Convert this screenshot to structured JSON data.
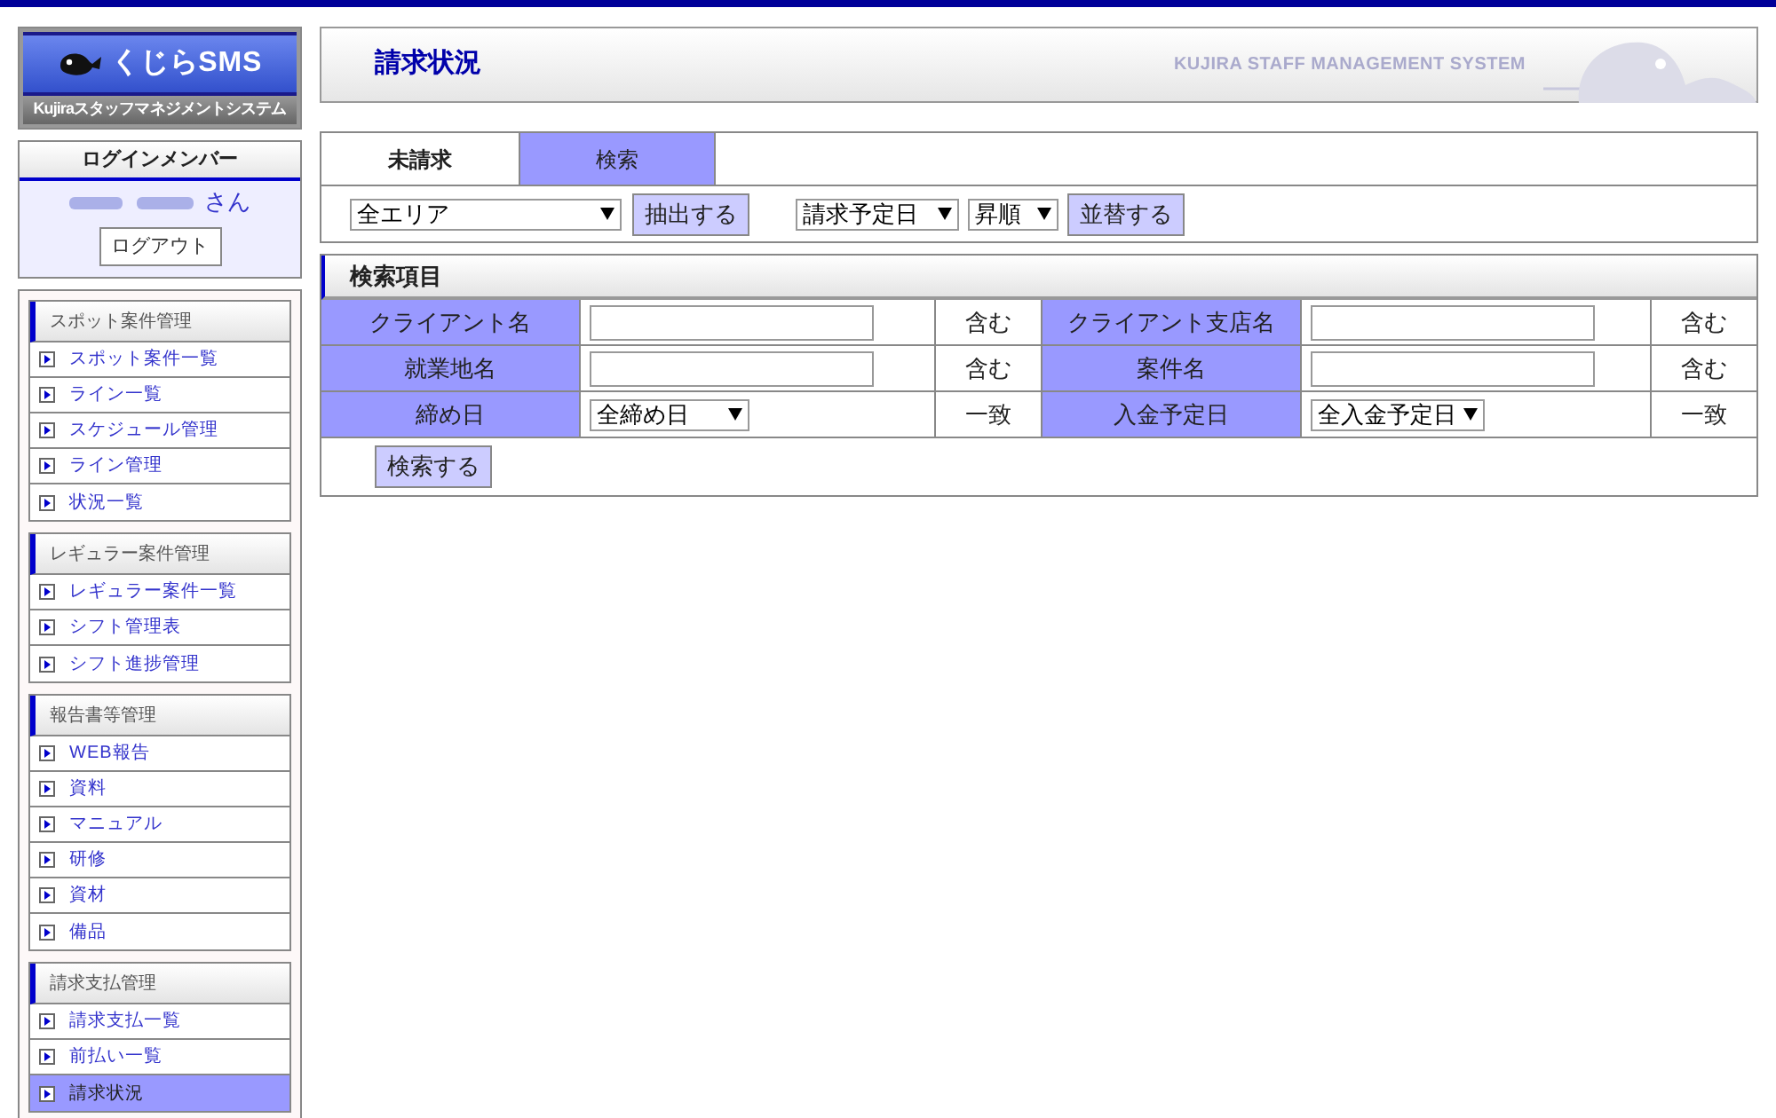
{
  "logo": {
    "title": "くじらSMS",
    "subtitle": "Kujiraスタッフマネジメントシステム"
  },
  "login": {
    "heading": "ログインメンバー",
    "suffix": "さん",
    "logout": "ログアウト"
  },
  "menu_groups": [
    {
      "title": "スポット案件管理",
      "items": [
        {
          "label": "スポット案件一覧",
          "selected": false
        },
        {
          "label": "ライン一覧",
          "selected": false
        },
        {
          "label": "スケジュール管理",
          "selected": false
        },
        {
          "label": "ライン管理",
          "selected": false
        },
        {
          "label": "状況一覧",
          "selected": false
        }
      ]
    },
    {
      "title": "レギュラー案件管理",
      "items": [
        {
          "label": "レギュラー案件一覧",
          "selected": false
        },
        {
          "label": "シフト管理表",
          "selected": false
        },
        {
          "label": "シフト進捗管理",
          "selected": false
        }
      ]
    },
    {
      "title": "報告書等管理",
      "items": [
        {
          "label": "WEB報告",
          "selected": false
        },
        {
          "label": "資料",
          "selected": false
        },
        {
          "label": "マニュアル",
          "selected": false
        },
        {
          "label": "研修",
          "selected": false
        },
        {
          "label": "資材",
          "selected": false
        },
        {
          "label": "備品",
          "selected": false
        }
      ]
    },
    {
      "title": "請求支払管理",
      "items": [
        {
          "label": "請求支払一覧",
          "selected": false
        },
        {
          "label": "前払い一覧",
          "selected": false
        },
        {
          "label": "請求状況",
          "selected": true
        }
      ]
    }
  ],
  "page": {
    "title": "請求状況",
    "system_name": "KUJIRA STAFF MANAGEMENT SYSTEM"
  },
  "tabs": [
    {
      "label": "未請求",
      "selected": false
    },
    {
      "label": "検索",
      "selected": true
    }
  ],
  "filter": {
    "area": "全エリア",
    "extract_button": "抽出する",
    "sort_key": "請求予定日",
    "order": "昇順",
    "sort_button": "並替する"
  },
  "search": {
    "title": "検索項目",
    "rows": [
      [
        {
          "label": "クライアント名",
          "field": {
            "kind": "text"
          },
          "match": "含む"
        },
        {
          "label": "クライアント支店名",
          "field": {
            "kind": "text"
          },
          "match": "含む"
        }
      ],
      [
        {
          "label": "就業地名",
          "field": {
            "kind": "text"
          },
          "match": "含む"
        },
        {
          "label": "案件名",
          "field": {
            "kind": "text"
          },
          "match": "含む"
        }
      ],
      [
        {
          "label": "締め日",
          "field": {
            "kind": "select",
            "value": "全締め日"
          },
          "match": "一致"
        },
        {
          "label": "入金予定日",
          "field": {
            "kind": "select",
            "value": "全入金予定日"
          },
          "match": "一致"
        }
      ]
    ],
    "button": "検索する"
  }
}
